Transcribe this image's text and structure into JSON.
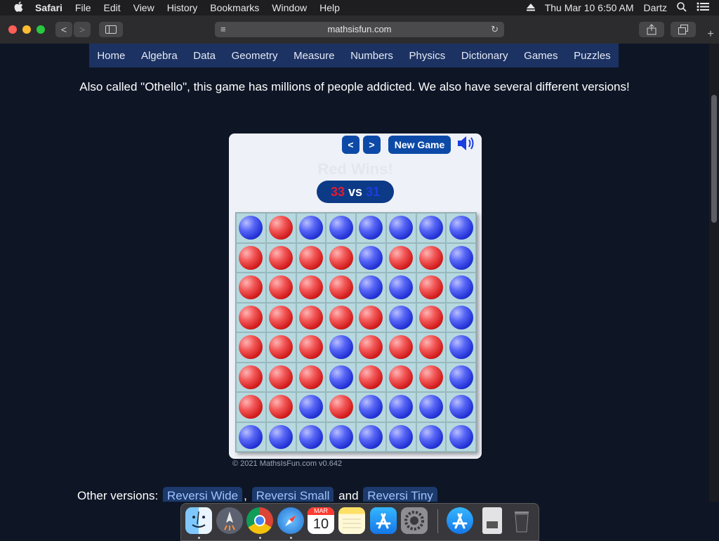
{
  "menubar": {
    "apple": "",
    "app": "Safari",
    "items": [
      "File",
      "Edit",
      "View",
      "History",
      "Bookmarks",
      "Window",
      "Help"
    ],
    "clock": "Thu Mar 10  6:50 AM",
    "user": "Dartz"
  },
  "toolbar": {
    "back": "<",
    "forward": ">",
    "url": "mathsisfun.com"
  },
  "nav": {
    "items": [
      "Home",
      "Algebra",
      "Data",
      "Geometry",
      "Measure",
      "Numbers",
      "Physics",
      "Dictionary",
      "Games",
      "Puzzles"
    ],
    "bg_color": "#1c3262"
  },
  "intro": "Also called \"Othello\", this game has millions of people addicted. We also have several different versions!",
  "game": {
    "prev": "<",
    "next": ">",
    "new_game": "New Game",
    "status": "Red Wins!",
    "score_red": "33",
    "score_vs": "vs",
    "score_blue": "31",
    "board": [
      "BRBBBBBB",
      "RRRRBRRB",
      "RRRRBBRB",
      "RRRRRBRB",
      "RRRBRRRB",
      "RRRBRRRB",
      "RRBRBBBB",
      "BBBBBBBB"
    ],
    "red_color": "#e01b34",
    "blue_color": "#1a3ee0",
    "button_color": "#0d4aa7"
  },
  "copyright": "© 2021 MathsIsFun.com v0.642",
  "other": {
    "label": "Other versions:",
    "links": [
      "Reversi Wide",
      "Reversi Small",
      "Reversi Tiny"
    ],
    "sep1": ",",
    "sep2": "and"
  },
  "dock": {
    "apps": [
      "finder-icon",
      "launchpad-icon",
      "chrome-icon",
      "safari-icon",
      "calendar-icon",
      "notes-icon",
      "app-store-icon",
      "system-preferences-icon",
      "downloads-icon",
      "documents-icon",
      "trash-icon"
    ],
    "calendar_month": "MAR",
    "calendar_day": "10"
  }
}
